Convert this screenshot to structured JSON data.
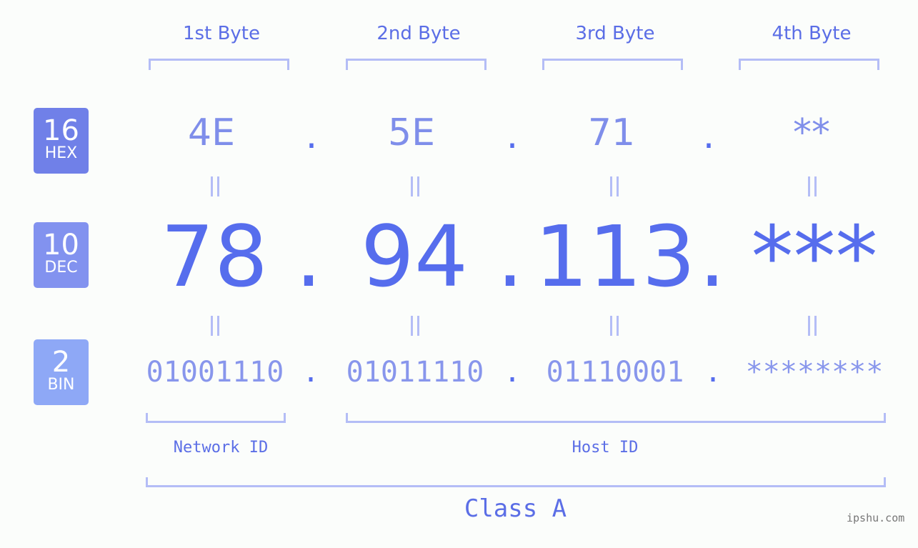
{
  "badges": [
    {
      "num": "16",
      "label": "HEX",
      "color": "#7080e8"
    },
    {
      "num": "10",
      "label": "DEC",
      "color": "#8292ef"
    },
    {
      "num": "2",
      "label": "BIN",
      "color": "#8ea8f6"
    }
  ],
  "bytes": [
    {
      "title": "1st Byte",
      "hex": "4E",
      "dec": "78",
      "bin": "01001110"
    },
    {
      "title": "2nd Byte",
      "hex": "5E",
      "dec": "94",
      "bin": "01011110"
    },
    {
      "title": "3rd Byte",
      "hex": "71",
      "dec": "113",
      "bin": "01110001"
    },
    {
      "title": "4th Byte",
      "hex": "**",
      "dec": "***",
      "bin": "********"
    }
  ],
  "separator": ".",
  "network_id_label": "Network ID",
  "host_id_label": "Host ID",
  "class_label": "Class A",
  "watermark": "ipshu.com"
}
